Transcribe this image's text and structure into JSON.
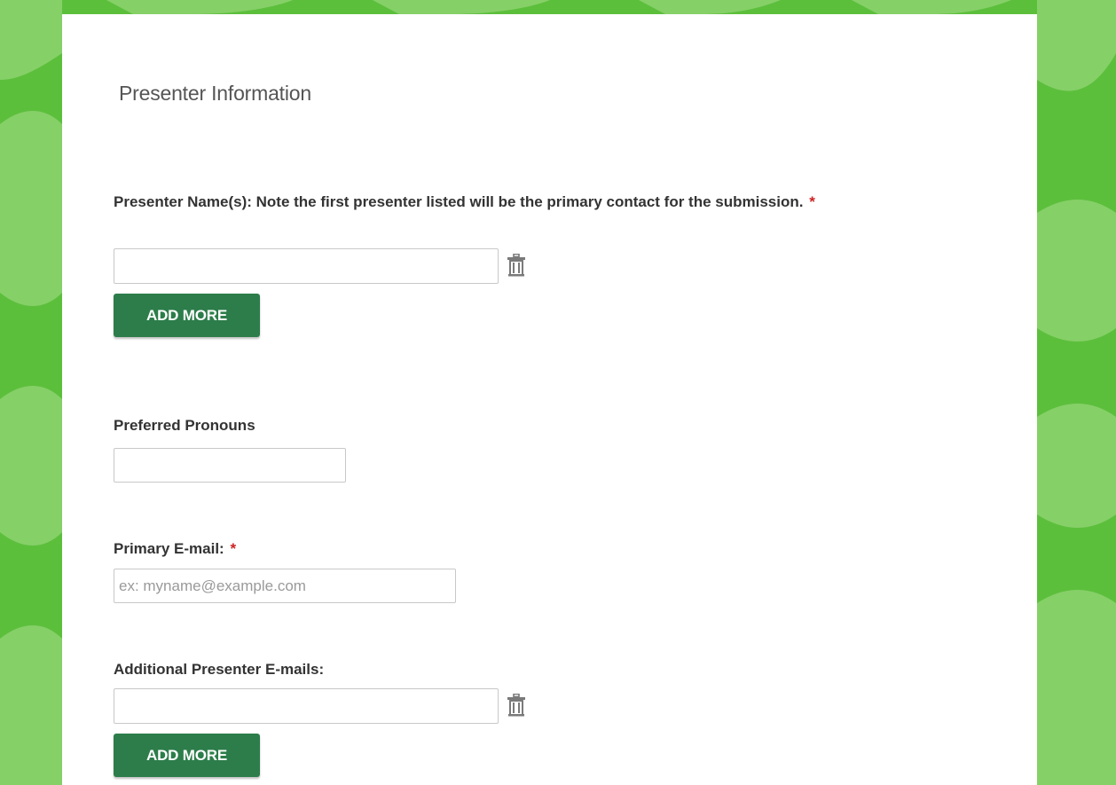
{
  "colors": {
    "background": "#5cbf3c",
    "background_light": "#86d068",
    "button": "#2c7d4a",
    "required": "#cc2222"
  },
  "section": {
    "title": "Presenter Information"
  },
  "presenter_names": {
    "label": "Presenter Name(s): Note the first presenter listed will be the primary contact for the submission.",
    "required_mark": "*",
    "value": "",
    "delete_icon": "trash-icon",
    "add_more_label": "ADD MORE"
  },
  "pronouns": {
    "label": "Preferred Pronouns",
    "value": ""
  },
  "primary_email": {
    "label": "Primary E-mail:",
    "required_mark": "*",
    "value": "",
    "placeholder": "ex: myname@example.com"
  },
  "additional_emails": {
    "label": "Additional Presenter E-mails:",
    "value": "",
    "delete_icon": "trash-icon",
    "add_more_label": "ADD MORE"
  }
}
